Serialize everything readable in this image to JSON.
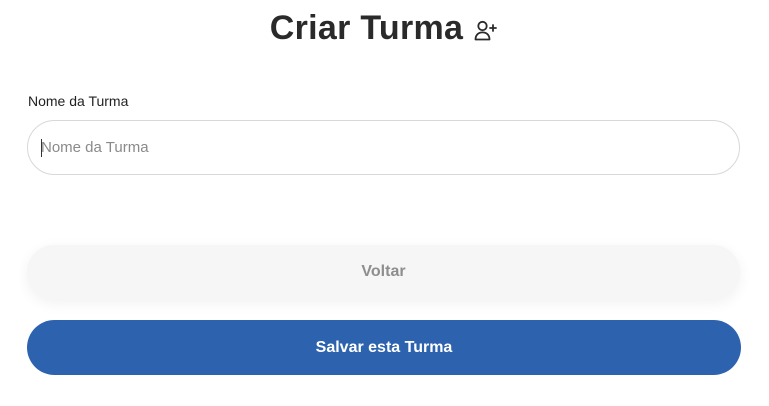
{
  "header": {
    "title": "Criar Turma",
    "icon": "user-plus-icon"
  },
  "form": {
    "name_label": "Nome da Turma",
    "name_placeholder": "Nome da Turma",
    "name_value": ""
  },
  "actions": {
    "back_label": "Voltar",
    "save_label": "Salvar esta Turma"
  },
  "colors": {
    "primary": "#2d63ae",
    "secondary_bg": "#f6f6f6",
    "secondary_text": "#8e8e8e"
  }
}
